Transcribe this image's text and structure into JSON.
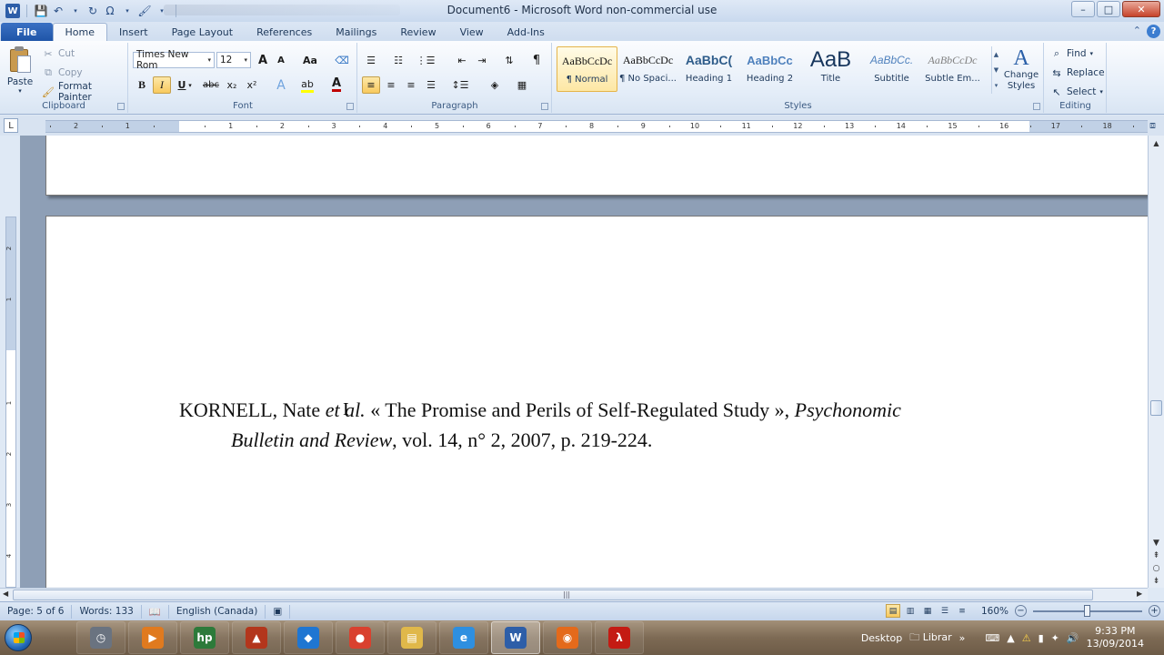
{
  "window": {
    "title": "Document6  -  Microsoft Word non-commercial use",
    "controls": {
      "minimize": "–",
      "maximize": "□",
      "close": "✕"
    }
  },
  "qat": {
    "save_icon": "save-icon",
    "undo_icon": "undo-icon",
    "redo_icon": "redo-icon",
    "symbol": "Ω"
  },
  "tabs": [
    "File",
    "Home",
    "Insert",
    "Page Layout",
    "References",
    "Mailings",
    "Review",
    "View",
    "Add-Ins"
  ],
  "active_tab": "Home",
  "clipboard": {
    "paste": "Paste",
    "cut": "Cut",
    "copy": "Copy",
    "format_painter": "Format Painter",
    "label": "Clipboard"
  },
  "font": {
    "family": "Times New Rom",
    "size": "12",
    "label": "Font",
    "bold": "B",
    "italic": "I",
    "underline": "U",
    "strike": "abc",
    "subscript": "x₂",
    "superscript": "x²",
    "grow": "A",
    "shrink": "A",
    "case": "Aa",
    "color_letter": "A"
  },
  "paragraph": {
    "label": "Paragraph",
    "pilcrow": "¶"
  },
  "styles": {
    "label": "Styles",
    "items": [
      {
        "sample": "AaBbCcDc",
        "name": "¶ Normal"
      },
      {
        "sample": "AaBbCcDc",
        "name": "¶ No Spaci..."
      },
      {
        "sample": "AaBbC(",
        "name": "Heading 1"
      },
      {
        "sample": "AaBbCc",
        "name": "Heading 2"
      },
      {
        "sample": "AaB",
        "name": "Title"
      },
      {
        "sample": "AaBbCc.",
        "name": "Subtitle"
      },
      {
        "sample": "AaBbCcDc",
        "name": "Subtle Em..."
      }
    ],
    "change_styles": "Change Styles",
    "change_styles_glyph": "A"
  },
  "editing": {
    "label": "Editing",
    "find": "Find",
    "replace": "Replace",
    "select": "Select"
  },
  "ruler": {
    "numbers": [
      "2",
      "1",
      "1",
      "2",
      "3",
      "4",
      "5",
      "6",
      "7",
      "8",
      "9",
      "10",
      "11",
      "12",
      "13",
      "14",
      "15",
      "16",
      "17",
      "18"
    ],
    "vnumbers": [
      "2",
      "1",
      "1",
      "2",
      "3",
      "4"
    ]
  },
  "document": {
    "line1_pre": "KORNELL, Nate ",
    "line1_italic": "et al.",
    "line1_post": " « The Promise and Perils of Self-Regulated Study », ",
    "line1_journal": "Psychonomic",
    "line2_journal": "Bulletin and Review",
    "line2_post": ", vol. 14, n° 2, 2007, p. 219-224."
  },
  "status": {
    "page": "Page: 5 of 6",
    "words": "Words: 133",
    "language": "English (Canada)",
    "zoom": "160%"
  },
  "taskbar": {
    "desktop": "Desktop",
    "libraries": "Librar",
    "time": "9:33 PM",
    "date": "13/09/2014",
    "apps": [
      {
        "name": "clock-app",
        "color": "#6a7380",
        "glyph": "◷"
      },
      {
        "name": "media-player",
        "color": "#e07a1f",
        "glyph": "▶"
      },
      {
        "name": "hp-app",
        "color": "#2d7a3a",
        "glyph": "hp"
      },
      {
        "name": "iron-app",
        "color": "#b3361c",
        "glyph": "▲"
      },
      {
        "name": "dropbox",
        "color": "#1f76d2",
        "glyph": "◆"
      },
      {
        "name": "chrome",
        "color": "#d9412f",
        "glyph": "●"
      },
      {
        "name": "explorer",
        "color": "#e0b84a",
        "glyph": "▤"
      },
      {
        "name": "internet-explorer",
        "color": "#2e8fe0",
        "glyph": "e"
      },
      {
        "name": "word",
        "color": "#2d5ea8",
        "glyph": "W"
      },
      {
        "name": "firefox",
        "color": "#e46a1b",
        "glyph": "◉"
      },
      {
        "name": "acrobat",
        "color": "#c41b13",
        "glyph": "λ"
      }
    ]
  }
}
